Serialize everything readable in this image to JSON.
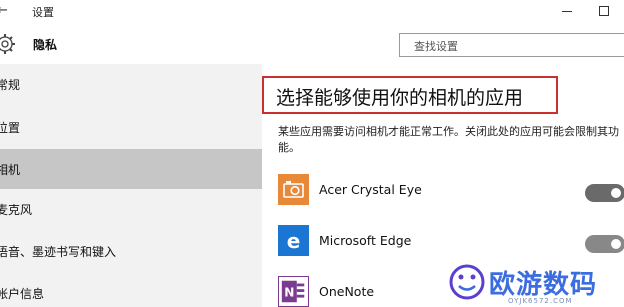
{
  "titlebar": {
    "back_glyph": "←",
    "title": "设置"
  },
  "header": {
    "section_title": "隐私",
    "search_placeholder": "查找设置"
  },
  "sidebar": {
    "items": [
      {
        "label": "常规",
        "selected": false
      },
      {
        "label": "位置",
        "selected": false
      },
      {
        "label": "相机",
        "selected": true
      },
      {
        "label": "麦克风",
        "selected": false
      },
      {
        "label": "语音、墨迹书写和键入",
        "selected": false
      },
      {
        "label": "帐户信息",
        "selected": false
      }
    ]
  },
  "main": {
    "title": "选择能够使用你的相机的应用",
    "description": "某些应用需要访问相机才能正常工作。关闭此处的应用可能会限制其功能。",
    "apps": [
      {
        "name": "Acer Crystal Eye",
        "toggle": "on"
      },
      {
        "name": "Microsoft Edge",
        "toggle": "on"
      },
      {
        "name": "OneNote",
        "toggle": ""
      }
    ]
  },
  "watermark": {
    "text": "欧游数码",
    "subtext": "OYJK6572.COM"
  },
  "colors": {
    "highlight_border": "#c9312e",
    "selected_item": "#c6c6c6",
    "sidebar_bg": "#f2f2f2",
    "toggle_on": "#6a6a6a"
  }
}
